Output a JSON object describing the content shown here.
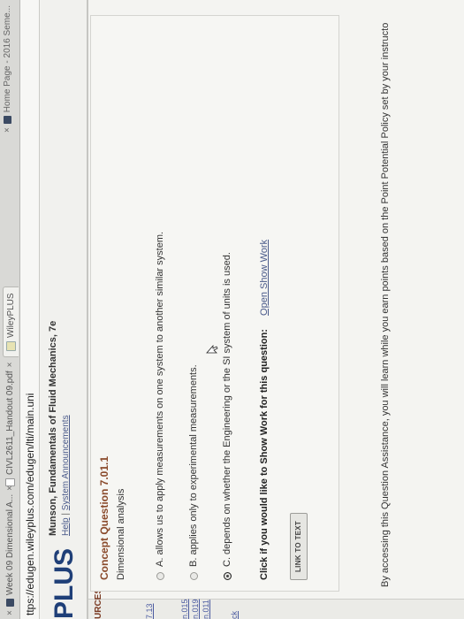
{
  "browser": {
    "tabs": [
      {
        "label": "Week 09 Dimensional A..."
      },
      {
        "label": "CIVL2611_Handout 09.pdf"
      },
      {
        "label": "WileyPLUS"
      },
      {
        "label": "Home Page - 2016 Seme..."
      }
    ],
    "url": "https://edugen.wileyplus.com/edugen/lti/main.uni",
    "url_visible": "ttps://edugen.wileyplus.com/edugen/lti/main.uni"
  },
  "header": {
    "logo": "PLUS",
    "book_title": "Munson, Fundamentals of Fluid Mechanics, 7e",
    "links": [
      "Help",
      "System Announcements"
    ]
  },
  "sidebar": {
    "heading": "URCES",
    "items": [
      "7.13",
      "n.015",
      "n.019",
      "n.011",
      "ck"
    ]
  },
  "question": {
    "title": "Concept Question 7.01.1",
    "subtitle": "Dimensional analysis",
    "options": [
      {
        "text": "A. allows us to apply measurements on one system to another similar system.",
        "selected": false
      },
      {
        "text": "B. applies only to experimental measurements.",
        "selected": false
      },
      {
        "text": "C. depends on whether the Engineering or the SI system of units is used.",
        "selected": true
      }
    ],
    "show_work_prompt": "Click if you would like to Show Work for this question:",
    "show_work_link": "Open Show Work",
    "link_button": "LINK TO TEXT"
  },
  "footer_text": "By accessing this Question Assistance, you will learn while you earn points based on the Point Potential Policy set by your instructo"
}
